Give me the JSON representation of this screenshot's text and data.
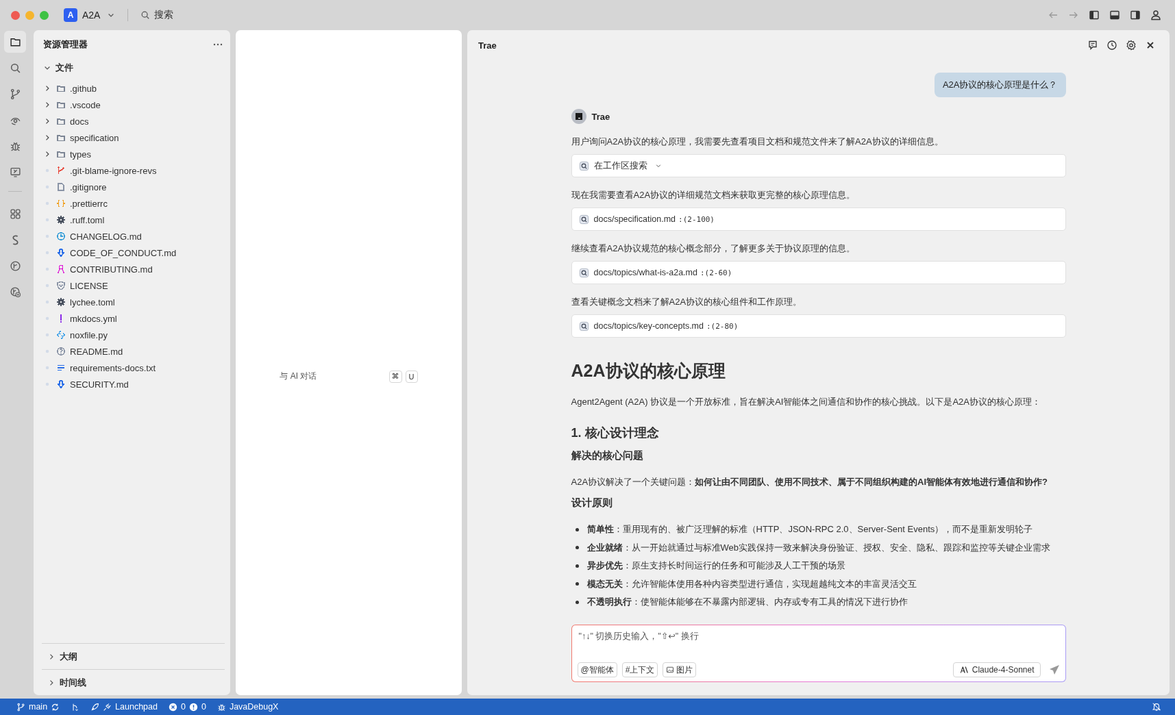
{
  "window": {
    "app_badge": "A",
    "project": "A2A",
    "search_placeholder": "搜索"
  },
  "activity_bar": [
    {
      "kind": "files",
      "selected": true
    },
    {
      "kind": "search",
      "selected": false
    },
    {
      "kind": "branch",
      "selected": false
    },
    {
      "kind": "eye",
      "selected": false
    },
    {
      "kind": "bug",
      "selected": false
    },
    {
      "kind": "remote",
      "selected": false
    },
    {
      "kind": "separator"
    },
    {
      "kind": "grid",
      "selected": false
    },
    {
      "kind": "s",
      "selected": false
    },
    {
      "kind": "flow",
      "selected": false
    },
    {
      "kind": "flow-add",
      "selected": false
    }
  ],
  "explorer": {
    "title": "资源管理器",
    "section": {
      "label": "文件",
      "expanded": true
    },
    "items": [
      {
        "name": ".github",
        "kind": "folder",
        "color": "#7c8594"
      },
      {
        "name": ".vscode",
        "kind": "folder",
        "color": "#7c8594"
      },
      {
        "name": "docs",
        "kind": "folder",
        "color": "#7c8594"
      },
      {
        "name": "specification",
        "kind": "folder",
        "color": "#7c8594"
      },
      {
        "name": "types",
        "kind": "folder",
        "color": "#7c8594"
      },
      {
        "name": ".git-blame-ignore-revs",
        "kind": "git",
        "color": "#e8463a"
      },
      {
        "name": ".gitignore",
        "kind": "doc",
        "color": "#8a94a6"
      },
      {
        "name": ".prettierrc",
        "kind": "braces",
        "color": "#f0a020"
      },
      {
        "name": ".ruff.toml",
        "kind": "gear",
        "color": "#4a5260"
      },
      {
        "name": "CHANGELOG.md",
        "kind": "clock",
        "color": "#3a9fd8"
      },
      {
        "name": "CODE_OF_CONDUCT.md",
        "kind": "down",
        "color": "#2a6ee8"
      },
      {
        "name": "CONTRIBUTING.md",
        "kind": "ribbon",
        "color": "#e030d8"
      },
      {
        "name": "LICENSE",
        "kind": "shield",
        "color": "#8a94a6"
      },
      {
        "name": "lychee.toml",
        "kind": "gear",
        "color": "#4a5260"
      },
      {
        "name": "mkdocs.yml",
        "kind": "bang",
        "color": "#8a2ae8"
      },
      {
        "name": "noxfile.py",
        "kind": "python",
        "color": "#3a9fe8"
      },
      {
        "name": "README.md",
        "kind": "help",
        "color": "#8a94a6"
      },
      {
        "name": "requirements-docs.txt",
        "kind": "lines",
        "color": "#2a6ee8"
      },
      {
        "name": "SECURITY.md",
        "kind": "down",
        "color": "#2a6ee8"
      }
    ],
    "bottom_sections": [
      {
        "label": "大纲",
        "expanded": false
      },
      {
        "label": "时间线",
        "expanded": false
      }
    ]
  },
  "middle_panel": {
    "hint": "与 AI 对话",
    "keys": [
      "⌘",
      "U"
    ]
  },
  "chat": {
    "title": "Trae",
    "messages": [
      {
        "kind": "user",
        "text": "A2A协议的核心原理是什么？"
      },
      {
        "kind": "assistant",
        "name": "Trae"
      },
      {
        "kind": "paragraph",
        "text": "用户询问A2A协议的核心原理，我需要先查看项目文档和规范文件来了解A2A协议的详细信息。"
      },
      {
        "kind": "tool",
        "label": "在工作区搜索",
        "expandable": true
      },
      {
        "kind": "paragraph",
        "text": "现在我需要查看A2A协议的详细规范文档来获取更完整的核心原理信息。"
      },
      {
        "kind": "tool",
        "label": "docs/specification.md",
        "range": ":(2-100)",
        "expandable": false
      },
      {
        "kind": "paragraph",
        "text": "继续查看A2A协议规范的核心概念部分，了解更多关于协议原理的信息。"
      },
      {
        "kind": "tool",
        "label": "docs/topics/what-is-a2a.md",
        "range": ":(2-60)",
        "expandable": false
      },
      {
        "kind": "paragraph",
        "text": "查看关键概念文档来了解A2A协议的核心组件和工作原理。"
      },
      {
        "kind": "tool",
        "label": "docs/topics/key-concepts.md",
        "range": ":(2-80)",
        "expandable": false
      },
      {
        "kind": "h1",
        "text": "A2A协议的核心原理"
      },
      {
        "kind": "paragraph",
        "text": "Agent2Agent (A2A) 协议是一个开放标准，旨在解决AI智能体之间通信和协作的核心挑战。以下是A2A协议的核心原理："
      },
      {
        "kind": "h2",
        "text": "1. 核心设计理念"
      },
      {
        "kind": "h3",
        "text": "解决的核心问题"
      },
      {
        "kind": "paragraph",
        "text": "A2A协议解决了一个关键问题：**如何让由不同团队、使用不同技术、属于不同组织构建的AI智能体有效地进行通信和协作?**"
      },
      {
        "kind": "h3",
        "text": "设计原则"
      },
      {
        "kind": "bullets",
        "items": [
          "**简单性**：重用现有的、被广泛理解的标准（HTTP、JSON-RPC 2.0、Server-Sent Events），而不是重新发明轮子",
          "**企业就绪**：从一开始就通过与标准Web实践保持一致来解决身份验证、授权、安全、隐私、跟踪和监控等关键企业需求",
          "**异步优先**：原生支持长时间运行的任务和可能涉及人工干预的场景",
          "**模态无关**：允许智能体使用各种内容类型进行通信，实现超越纯文本的丰富灵活交互",
          "**不透明执行**：使智能体能够在不暴露内部逻辑、内存或专有工具的情况下进行协作"
        ]
      }
    ],
    "input": {
      "placeholder": "\"↑↓\" 切换历史输入，\"⇧↩\" 换行",
      "chips": [
        {
          "kind": "at",
          "label": "@智能体"
        },
        {
          "kind": "hash",
          "label": "#上下文"
        },
        {
          "kind": "image",
          "label": "图片"
        }
      ],
      "model": "Claude-4-Sonnet"
    }
  },
  "status_bar": {
    "branch": "main",
    "launchpad": "Launchpad",
    "errors": "0",
    "warnings": "0",
    "debugger": "JavaDebugX"
  }
}
